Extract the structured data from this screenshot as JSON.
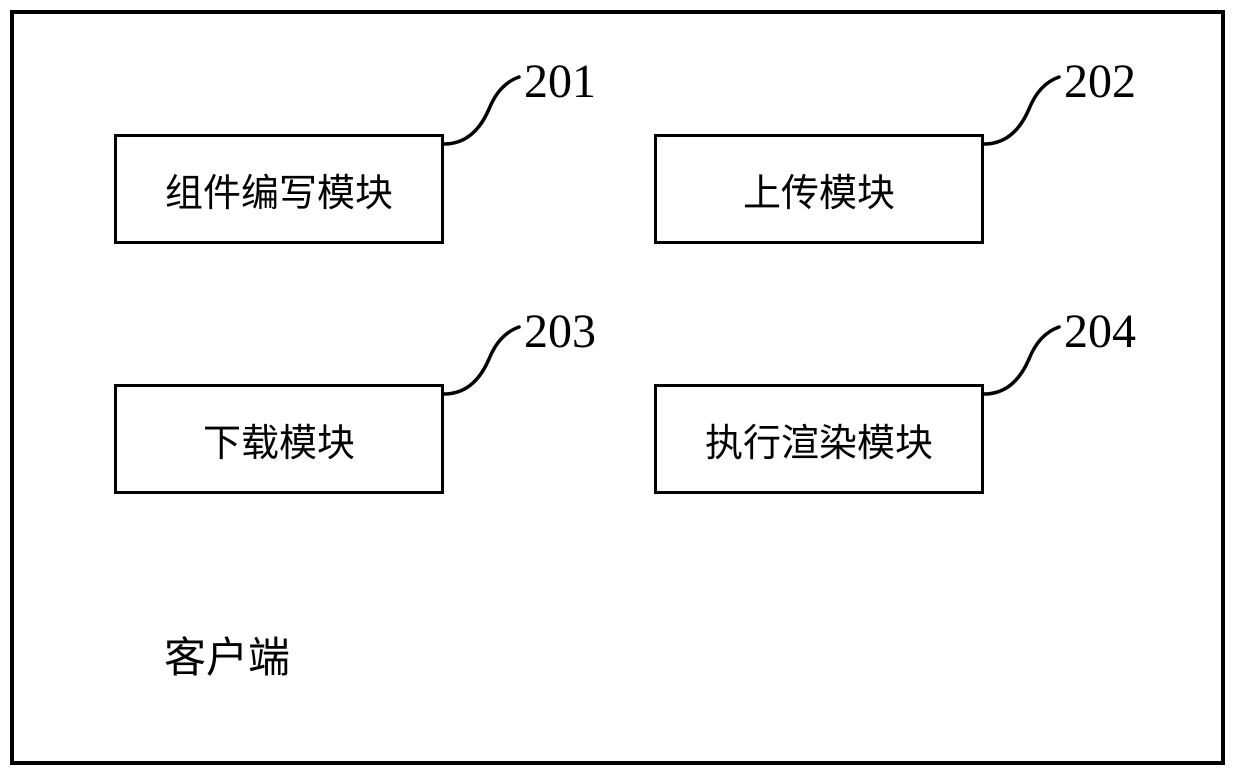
{
  "boxes": {
    "b201": {
      "label": "组件编写模块",
      "num": "201"
    },
    "b202": {
      "label": "上传模块",
      "num": "202"
    },
    "b203": {
      "label": "下载模块",
      "num": "203"
    },
    "b204": {
      "label": "执行渲染模块",
      "num": "204"
    }
  },
  "footer": "客户端"
}
